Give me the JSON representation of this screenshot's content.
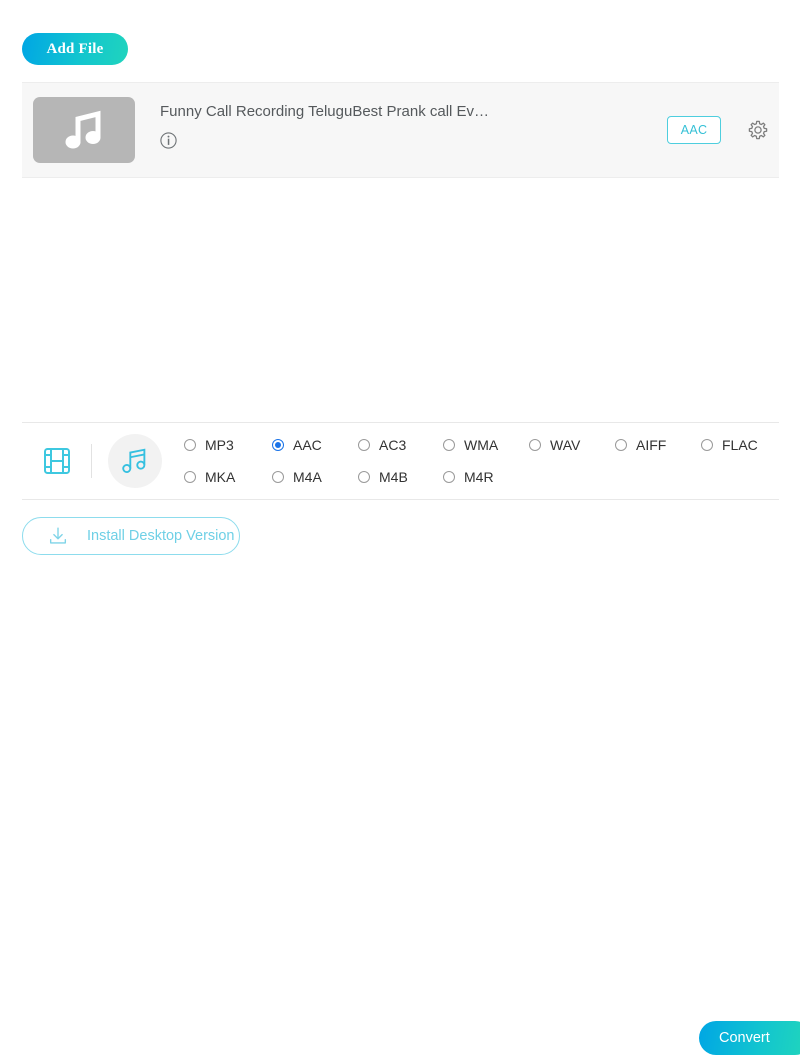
{
  "toolbar": {
    "add_file_label": "Add File"
  },
  "file_list": {
    "rows": [
      {
        "title": "Funny Call Recording TeluguBest Prank call Ev…",
        "thumb_icon": "music-note-icon",
        "info_icon": "info-icon",
        "format_badge": "AAC",
        "settings_icon": "gear-icon"
      }
    ]
  },
  "format_bar": {
    "video_icon": "film-strip-icon",
    "audio_icon": "music-note-icon",
    "rows": [
      [
        {
          "label": "MP3",
          "selected": false
        },
        {
          "label": "AAC",
          "selected": true
        },
        {
          "label": "AC3",
          "selected": false
        },
        {
          "label": "WMA",
          "selected": false
        },
        {
          "label": "WAV",
          "selected": false
        },
        {
          "label": "AIFF",
          "selected": false
        },
        {
          "label": "FLAC",
          "selected": false
        }
      ],
      [
        {
          "label": "MKA",
          "selected": false
        },
        {
          "label": "M4A",
          "selected": false
        },
        {
          "label": "M4B",
          "selected": false
        },
        {
          "label": "M4R",
          "selected": false
        }
      ]
    ]
  },
  "bottom_bar": {
    "install_label": "Install Desktop Version",
    "install_icon": "download-icon",
    "convert_label": "Convert"
  },
  "colors": {
    "accent_start": "#00a6e4",
    "accent_end": "#22d7ba",
    "badge_border": "#4ecede",
    "badge_text": "#35c0d6",
    "radio_selected": "#1a73e8",
    "install_outline": "#8ddced",
    "install_text": "#6fd0e6",
    "row_bg": "#f7f7f7",
    "thumb_bg": "#b6b6b6"
  }
}
